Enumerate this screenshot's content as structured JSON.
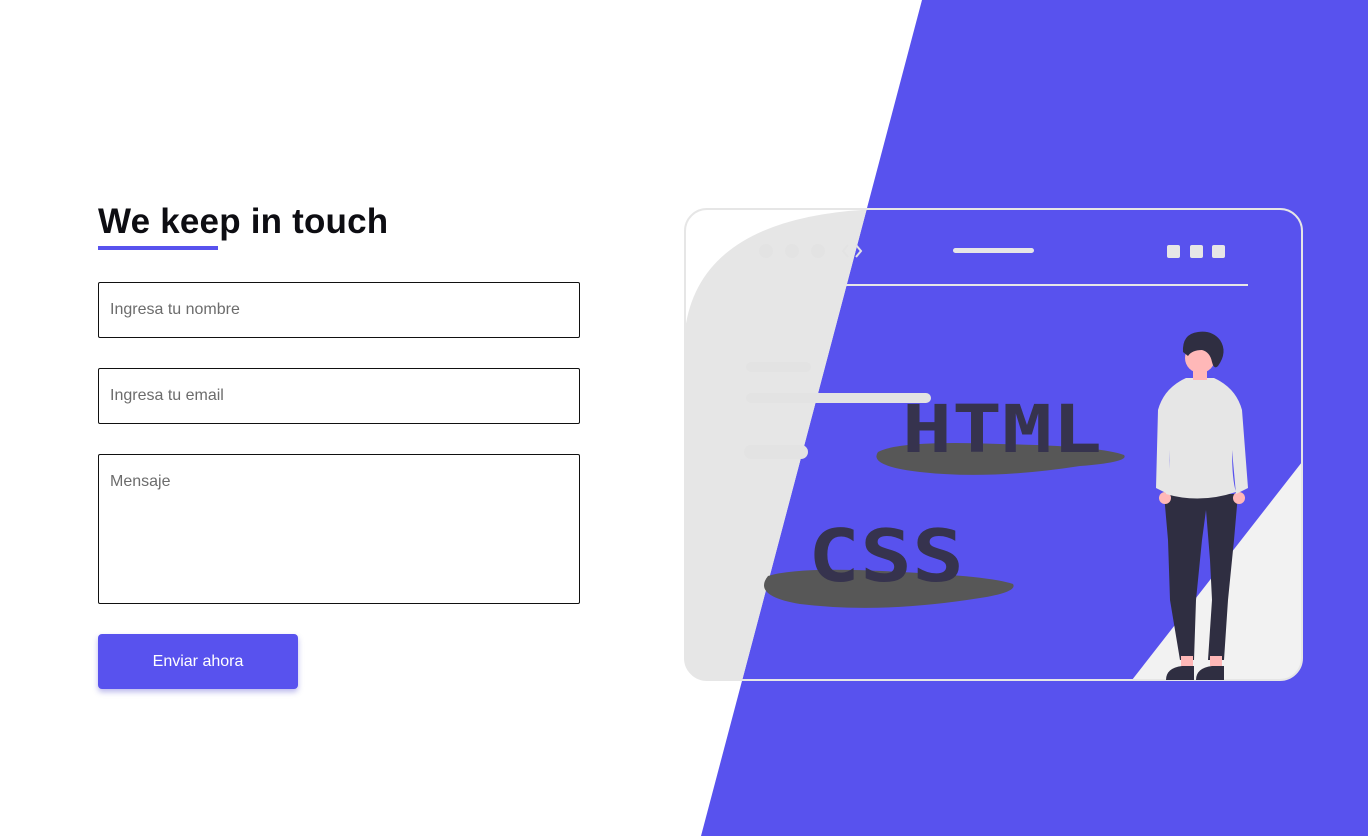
{
  "form": {
    "title": "We keep in touch",
    "name_placeholder": "Ingresa tu nombre",
    "email_placeholder": "Ingresa tu email",
    "message_placeholder": "Mensaje",
    "submit_label": "Enviar ahora"
  },
  "illustration": {
    "html_label": "HTML",
    "css_label": "CSS"
  },
  "colors": {
    "accent": "#5852ee",
    "panel_gray": "#e5e5e5",
    "dark_label": "#36334e"
  }
}
